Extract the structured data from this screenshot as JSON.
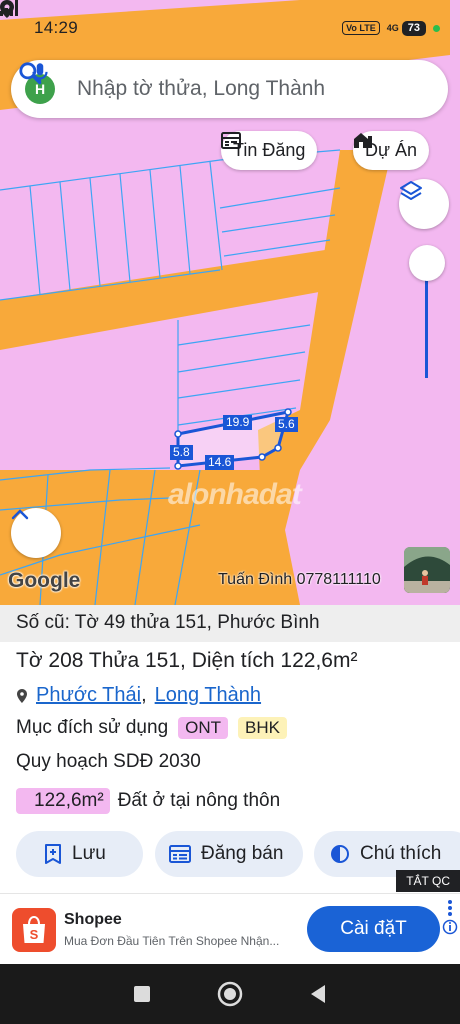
{
  "status_bar": {
    "time": "14:29",
    "volte": "Vo LTE",
    "network": "4G",
    "battery": "73"
  },
  "search": {
    "avatar_letter": "H",
    "query": "Nhập tờ thửa, Long Thành"
  },
  "chips": {
    "listings": "Tin Đăng",
    "projects": "Dự Án"
  },
  "map": {
    "parcel_edges": [
      "19.9",
      "5.6",
      "5.8",
      "14.6"
    ],
    "watermark": "alonhadat",
    "attribution": "Google",
    "photo_credit": "Tuấn Đình 0778111110",
    "zoom_level": 0.9
  },
  "parcel": {
    "old_reference": "Số cũ: Tờ 49 thửa 151, Phước Bình",
    "title": "Tờ 208 Thửa 151, Diện tích 122,6m²",
    "commune": "Phước Thái",
    "district": "Long Thành",
    "purpose_label": "Mục đích sử dụng",
    "purpose_tags": [
      {
        "code": "ONT",
        "color": "#f3b8f0"
      },
      {
        "code": "BHK",
        "color": "#fdf2b8"
      }
    ],
    "plan_label": "Quy hoạch SDĐ 2030",
    "area_badge": "122,6m²",
    "area_use": "Đất ở tại nông thôn"
  },
  "actions": {
    "save": "Lưu",
    "post_sale": "Đăng bán",
    "legend": "Chú thích"
  },
  "ad": {
    "close_label": "TẮT QC",
    "advertiser": "Shopee",
    "description": "Mua Đơn Đầu Tiên Trên Shopee Nhận...",
    "cta": "Cài đặT"
  },
  "colors": {
    "rural_residential": "#f3b8f0",
    "road": "#f8a93a",
    "accent_blue": "#1a63d6",
    "plot_lines": "#3da5f4"
  }
}
